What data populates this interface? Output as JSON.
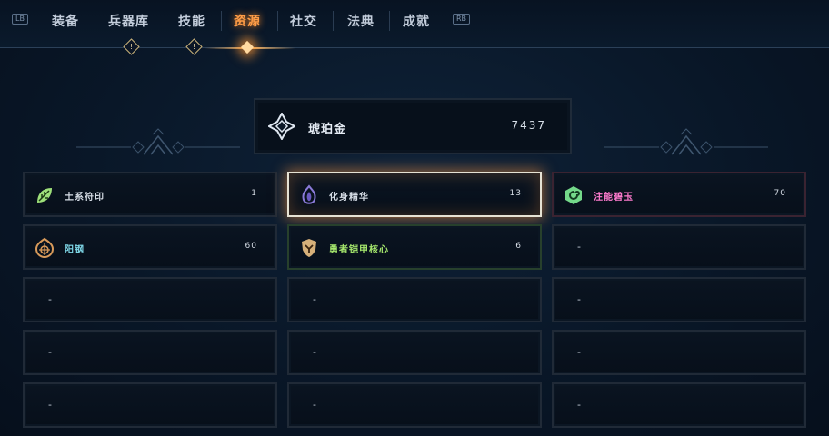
{
  "nav": {
    "left_bumper": "LB",
    "right_bumper": "RB",
    "tabs": [
      {
        "label": "装备"
      },
      {
        "label": "兵器库"
      },
      {
        "label": "技能"
      },
      {
        "label": "资源",
        "active": true
      },
      {
        "label": "社交"
      },
      {
        "label": "法典"
      },
      {
        "label": "成就"
      }
    ],
    "badges": [
      "!",
      "!"
    ]
  },
  "featured": {
    "name": "琥珀金",
    "count": "7437",
    "icon": "diamond-star-icon"
  },
  "resources": [
    {
      "name": "土系符印",
      "count": "1",
      "icon": "leaf-rune-icon",
      "name_color": "#d6dde6",
      "icon_color": "#9ee07a"
    },
    {
      "name": "化身精华",
      "count": "13",
      "icon": "flame-essence-icon",
      "name_color": "#d6dde6",
      "icon_color": "#8a7ad8",
      "selected": true
    },
    {
      "name": "注能碧玉",
      "count": "70",
      "icon": "jade-swirl-icon",
      "name_color": "#ff7ccf",
      "icon_color": "#74d98a"
    },
    {
      "name": "阳钢",
      "count": "60",
      "icon": "sun-steel-icon",
      "name_color": "#7fd8e8",
      "icon_color": "#d89a5a"
    },
    {
      "name": "勇者铠甲核心",
      "count": "6",
      "icon": "armor-core-icon",
      "name_color": "#a6e86d",
      "icon_color": "#d6b07a"
    },
    {
      "name": "-",
      "empty": true
    },
    {
      "name": "-",
      "empty": true
    },
    {
      "name": "-",
      "empty": true
    },
    {
      "name": "-",
      "empty": true
    },
    {
      "name": "-",
      "empty": true
    },
    {
      "name": "-",
      "empty": true
    },
    {
      "name": "-",
      "empty": true
    },
    {
      "name": "-",
      "empty": true
    },
    {
      "name": "-",
      "empty": true
    },
    {
      "name": "-",
      "empty": true
    }
  ],
  "colors": {
    "accent": "#ff9d47",
    "selected_border": "#e6e2d4"
  }
}
